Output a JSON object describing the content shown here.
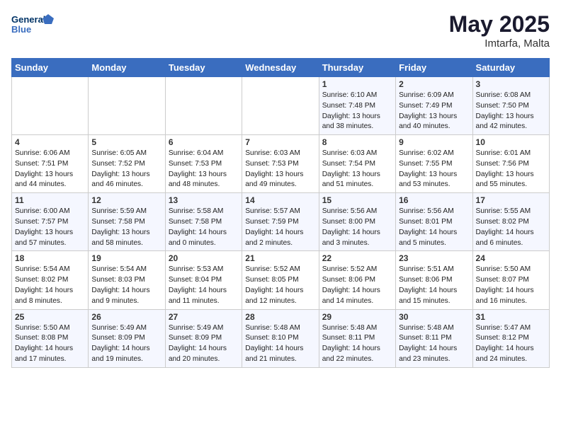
{
  "header": {
    "logo_line1": "General",
    "logo_line2": "Blue",
    "month_year": "May 2025",
    "location": "Imtarfa, Malta"
  },
  "weekdays": [
    "Sunday",
    "Monday",
    "Tuesday",
    "Wednesday",
    "Thursday",
    "Friday",
    "Saturday"
  ],
  "weeks": [
    [
      {
        "day": "",
        "text": ""
      },
      {
        "day": "",
        "text": ""
      },
      {
        "day": "",
        "text": ""
      },
      {
        "day": "",
        "text": ""
      },
      {
        "day": "1",
        "text": "Sunrise: 6:10 AM\nSunset: 7:48 PM\nDaylight: 13 hours\nand 38 minutes."
      },
      {
        "day": "2",
        "text": "Sunrise: 6:09 AM\nSunset: 7:49 PM\nDaylight: 13 hours\nand 40 minutes."
      },
      {
        "day": "3",
        "text": "Sunrise: 6:08 AM\nSunset: 7:50 PM\nDaylight: 13 hours\nand 42 minutes."
      }
    ],
    [
      {
        "day": "4",
        "text": "Sunrise: 6:06 AM\nSunset: 7:51 PM\nDaylight: 13 hours\nand 44 minutes."
      },
      {
        "day": "5",
        "text": "Sunrise: 6:05 AM\nSunset: 7:52 PM\nDaylight: 13 hours\nand 46 minutes."
      },
      {
        "day": "6",
        "text": "Sunrise: 6:04 AM\nSunset: 7:53 PM\nDaylight: 13 hours\nand 48 minutes."
      },
      {
        "day": "7",
        "text": "Sunrise: 6:03 AM\nSunset: 7:53 PM\nDaylight: 13 hours\nand 49 minutes."
      },
      {
        "day": "8",
        "text": "Sunrise: 6:03 AM\nSunset: 7:54 PM\nDaylight: 13 hours\nand 51 minutes."
      },
      {
        "day": "9",
        "text": "Sunrise: 6:02 AM\nSunset: 7:55 PM\nDaylight: 13 hours\nand 53 minutes."
      },
      {
        "day": "10",
        "text": "Sunrise: 6:01 AM\nSunset: 7:56 PM\nDaylight: 13 hours\nand 55 minutes."
      }
    ],
    [
      {
        "day": "11",
        "text": "Sunrise: 6:00 AM\nSunset: 7:57 PM\nDaylight: 13 hours\nand 57 minutes."
      },
      {
        "day": "12",
        "text": "Sunrise: 5:59 AM\nSunset: 7:58 PM\nDaylight: 13 hours\nand 58 minutes."
      },
      {
        "day": "13",
        "text": "Sunrise: 5:58 AM\nSunset: 7:58 PM\nDaylight: 14 hours\nand 0 minutes."
      },
      {
        "day": "14",
        "text": "Sunrise: 5:57 AM\nSunset: 7:59 PM\nDaylight: 14 hours\nand 2 minutes."
      },
      {
        "day": "15",
        "text": "Sunrise: 5:56 AM\nSunset: 8:00 PM\nDaylight: 14 hours\nand 3 minutes."
      },
      {
        "day": "16",
        "text": "Sunrise: 5:56 AM\nSunset: 8:01 PM\nDaylight: 14 hours\nand 5 minutes."
      },
      {
        "day": "17",
        "text": "Sunrise: 5:55 AM\nSunset: 8:02 PM\nDaylight: 14 hours\nand 6 minutes."
      }
    ],
    [
      {
        "day": "18",
        "text": "Sunrise: 5:54 AM\nSunset: 8:02 PM\nDaylight: 14 hours\nand 8 minutes."
      },
      {
        "day": "19",
        "text": "Sunrise: 5:54 AM\nSunset: 8:03 PM\nDaylight: 14 hours\nand 9 minutes."
      },
      {
        "day": "20",
        "text": "Sunrise: 5:53 AM\nSunset: 8:04 PM\nDaylight: 14 hours\nand 11 minutes."
      },
      {
        "day": "21",
        "text": "Sunrise: 5:52 AM\nSunset: 8:05 PM\nDaylight: 14 hours\nand 12 minutes."
      },
      {
        "day": "22",
        "text": "Sunrise: 5:52 AM\nSunset: 8:06 PM\nDaylight: 14 hours\nand 14 minutes."
      },
      {
        "day": "23",
        "text": "Sunrise: 5:51 AM\nSunset: 8:06 PM\nDaylight: 14 hours\nand 15 minutes."
      },
      {
        "day": "24",
        "text": "Sunrise: 5:50 AM\nSunset: 8:07 PM\nDaylight: 14 hours\nand 16 minutes."
      }
    ],
    [
      {
        "day": "25",
        "text": "Sunrise: 5:50 AM\nSunset: 8:08 PM\nDaylight: 14 hours\nand 17 minutes."
      },
      {
        "day": "26",
        "text": "Sunrise: 5:49 AM\nSunset: 8:09 PM\nDaylight: 14 hours\nand 19 minutes."
      },
      {
        "day": "27",
        "text": "Sunrise: 5:49 AM\nSunset: 8:09 PM\nDaylight: 14 hours\nand 20 minutes."
      },
      {
        "day": "28",
        "text": "Sunrise: 5:48 AM\nSunset: 8:10 PM\nDaylight: 14 hours\nand 21 minutes."
      },
      {
        "day": "29",
        "text": "Sunrise: 5:48 AM\nSunset: 8:11 PM\nDaylight: 14 hours\nand 22 minutes."
      },
      {
        "day": "30",
        "text": "Sunrise: 5:48 AM\nSunset: 8:11 PM\nDaylight: 14 hours\nand 23 minutes."
      },
      {
        "day": "31",
        "text": "Sunrise: 5:47 AM\nSunset: 8:12 PM\nDaylight: 14 hours\nand 24 minutes."
      }
    ]
  ]
}
